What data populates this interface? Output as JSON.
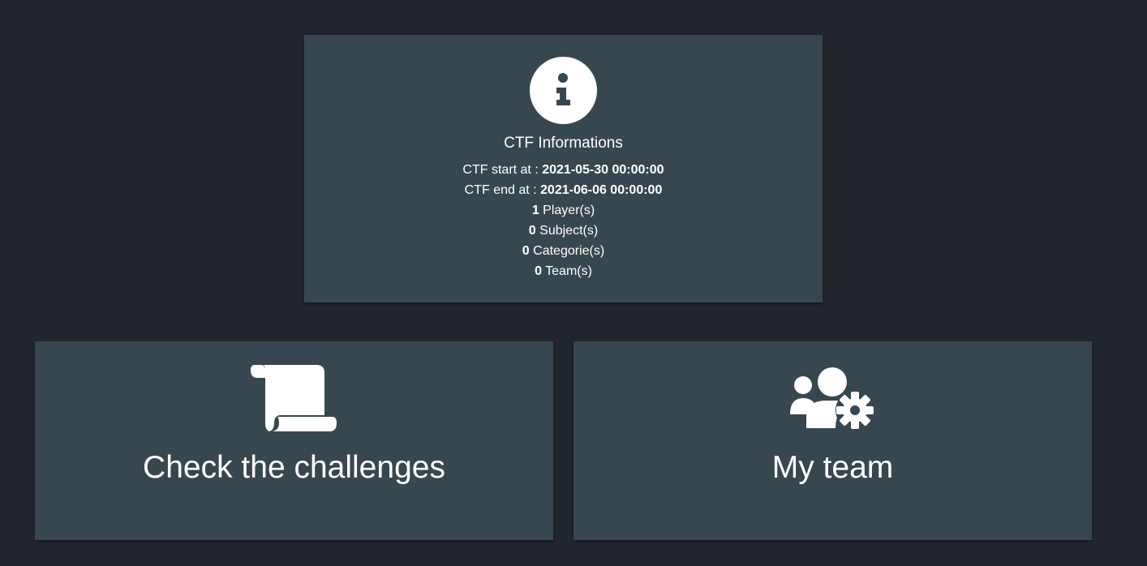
{
  "info": {
    "icon": "info-icon",
    "title": "CTF Informations",
    "start_label": "CTF start at :",
    "start_value": "2021-05-30 00:00:00",
    "end_label": "CTF end at :",
    "end_value": "2021-06-06 00:00:00",
    "players_count": "1",
    "players_label": "Player(s)",
    "subjects_count": "0",
    "subjects_label": "Subject(s)",
    "categories_count": "0",
    "categories_label": "Categorie(s)",
    "teams_count": "0",
    "teams_label": "Team(s)"
  },
  "actions": {
    "challenges": {
      "icon": "scroll-icon",
      "label": "Check the challenges"
    },
    "team": {
      "icon": "users-gear-icon",
      "label": "My team"
    }
  },
  "colors": {
    "background": "#21252c",
    "card": "#37474f",
    "text": "#ffffff"
  }
}
